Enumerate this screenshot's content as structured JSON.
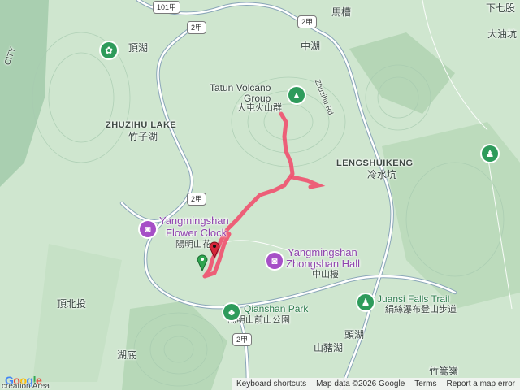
{
  "map": {
    "places": {
      "gonglu_top": "101甲",
      "route2_top": "2甲",
      "macao": "馬槽",
      "xiaqihu": "下七股",
      "dayoukeng": "大油坑",
      "dinghu": "頂湖",
      "zhonghu": "中湖",
      "tatun_en_1": "Tatun Volcano",
      "tatun_en_2": "Group",
      "tatun_zh": "大屯火山群",
      "zhuzihu_en": "ZHUZIHU LAKE",
      "zhuzihu_zh": "竹子湖",
      "lengshuikeng_en": "LENGSHUIKENG",
      "lengshuikeng_zh": "冷水坑",
      "route2_mid": "2甲",
      "flowerclock_en": "Yangmingshan",
      "flowerclock_en2": "Flower Clock",
      "flowerclock_zh": "陽明山花",
      "zhongshan_en": "Yangmingshan",
      "zhongshan_en2": "Zhongshan Hall",
      "zhongshan_zh": "中山樓",
      "qianshan_en": "Qianshan Park",
      "qianshan_zh": "陽明山前山公園",
      "juansi_en": "Juansi Falls Trail",
      "juansi_zh": "絹絲瀑布登山步道",
      "dingbeitou": "頂北投",
      "toutu": "頭湖",
      "shanzhuhu": "山豬湖",
      "hudi": "湖底",
      "route2_bottom": "2甲",
      "zhuxiling": "竹篙嶺",
      "zhuzihu_rd": "Zhuzihu Rd",
      "city": "CITY",
      "recreation": "creation Area"
    },
    "footer": {
      "shortcuts": "Keyboard shortcuts",
      "mapdata": "Map data ©2026 Google",
      "terms": "Terms",
      "report": "Report a map error"
    },
    "logo": "Google",
    "colors": {
      "terrain": "#cfe6cf",
      "track": "#f0506e",
      "road": "#ffffff"
    }
  }
}
